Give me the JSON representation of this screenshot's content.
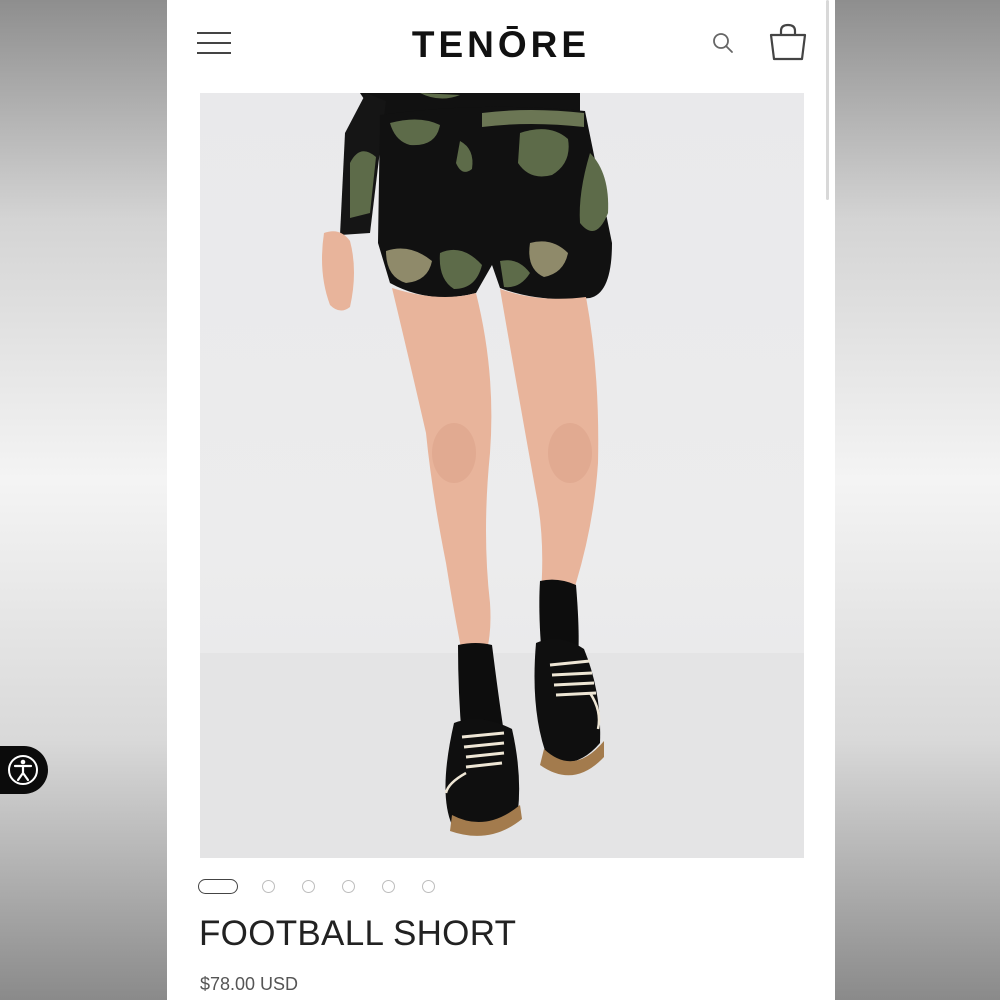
{
  "header": {
    "logo": "TENŌRE",
    "menu_icon": "hamburger-menu-icon",
    "search_icon": "search-icon",
    "bag_icon": "shopping-bag-icon"
  },
  "product": {
    "title": "FOOTBALL SHORT",
    "price": "$78.00 USD",
    "image_alt_subject": "model wearing black camo-print shorts with black socks and lace-up sneakers"
  },
  "carousel": {
    "total_slides": 6,
    "active_index": 0
  },
  "accessibility": {
    "icon": "accessibility-icon"
  },
  "colors": {
    "shorts_black": "#111111",
    "camo_green": "#5d6b49",
    "camo_tan": "#8f8a6a",
    "skin": "#e8b49b",
    "sole": "#a37b4d",
    "background": "#eaeaec"
  }
}
